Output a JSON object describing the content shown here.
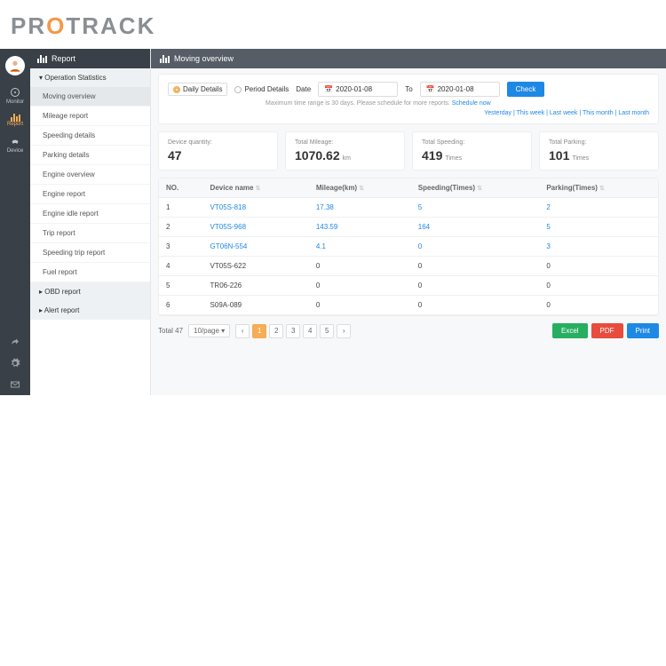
{
  "logo": {
    "pre": "PR",
    "accent": "O",
    "post": "TRACK"
  },
  "nav": {
    "monitor": "Monitor",
    "report": "Report",
    "device": "Device"
  },
  "sidebar": {
    "title": "Report",
    "groups": [
      "Operation Statistics",
      "OBD report",
      "Alert report"
    ],
    "items": [
      "Moving overview",
      "Mileage report",
      "Speeding details",
      "Parking details",
      "Engine overview",
      "Engine report",
      "Engine idle report",
      "Trip report",
      "Speeding trip report",
      "Fuel report"
    ]
  },
  "header": {
    "title": "Moving overview"
  },
  "filters": {
    "daily": "Daily Details",
    "period": "Period Details",
    "date_lbl": "Date",
    "to_lbl": "To",
    "from": "2020-01-08",
    "to": "2020-01-08",
    "check": "Check",
    "hint": "Maximum time range is 30 days. Please schedule for more reports.",
    "schedule": "Schedule now",
    "quick": [
      "Yesterday",
      "This week",
      "Last week",
      "This month",
      "Last month"
    ]
  },
  "cards": [
    {
      "lbl": "Device quantity:",
      "val": "47",
      "unit": ""
    },
    {
      "lbl": "Total Mileage:",
      "val": "1070.62",
      "unit": "km"
    },
    {
      "lbl": "Total Speeding:",
      "val": "419",
      "unit": "Times"
    },
    {
      "lbl": "Total Parking:",
      "val": "101",
      "unit": "Times"
    }
  ],
  "table": {
    "cols": [
      "NO.",
      "Device name",
      "Mileage(km)",
      "Speeding(Times)",
      "Parking(Times)"
    ],
    "rows": [
      {
        "no": "1",
        "name": "VT05S-818",
        "mileage": "17.38",
        "speed": "5",
        "park": "2",
        "link": true
      },
      {
        "no": "2",
        "name": "VT05S-968",
        "mileage": "143.59",
        "speed": "164",
        "park": "5",
        "link": true
      },
      {
        "no": "3",
        "name": "GT06N-554",
        "mileage": "4.1",
        "speed": "0",
        "park": "3",
        "link": true
      },
      {
        "no": "4",
        "name": "VT05S-622",
        "mileage": "0",
        "speed": "0",
        "park": "0",
        "link": false
      },
      {
        "no": "5",
        "name": "TR06-226",
        "mileage": "0",
        "speed": "0",
        "park": "0",
        "link": false
      },
      {
        "no": "6",
        "name": "S09A-089",
        "mileage": "0",
        "speed": "0",
        "park": "0",
        "link": false
      }
    ]
  },
  "footer": {
    "total": "Total 47",
    "perpage": "10/page",
    "pages": [
      "1",
      "2",
      "3",
      "4",
      "5"
    ],
    "excel": "Excel",
    "pdf": "PDF",
    "print": "Print"
  }
}
